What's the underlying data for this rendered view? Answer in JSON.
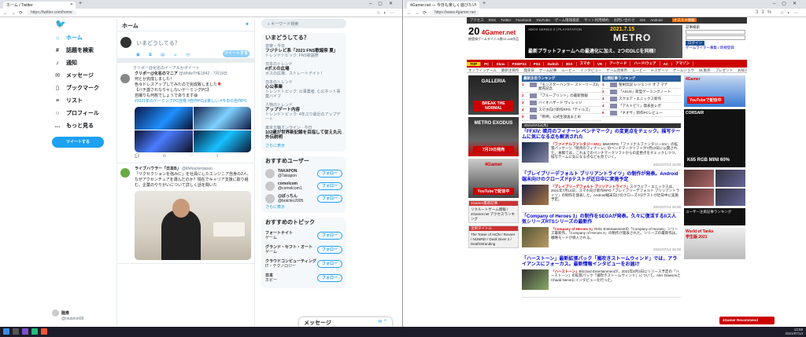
{
  "left_window": {
    "tab_title": "ホーム / Twitter",
    "url": "https://twitter.com/home",
    "nav": [
      {
        "icon": "home-icon",
        "glyph": "⌂",
        "label": "ホーム"
      },
      {
        "icon": "hashtag-icon",
        "glyph": "#",
        "label": "話題を検索"
      },
      {
        "icon": "bell-icon",
        "glyph": "♪",
        "label": "通知"
      },
      {
        "icon": "mail-icon",
        "glyph": "✉",
        "label": "メッセージ"
      },
      {
        "icon": "bookmark-icon",
        "glyph": "▯",
        "label": "ブックマーク"
      },
      {
        "icon": "list-icon",
        "glyph": "≡",
        "label": "リスト"
      },
      {
        "icon": "profile-icon",
        "glyph": "○",
        "label": "プロフィール"
      },
      {
        "icon": "more-icon",
        "glyph": "…",
        "label": "もっと見る"
      }
    ],
    "tweet_button": "ツイートする",
    "user": {
      "name": "陸斎",
      "handle": "@mutekiri08"
    },
    "main": {
      "title": "ホーム",
      "compose_placeholder": "いまどうしてる？",
      "compose_button": "ツイートする",
      "tweets": [
        {
          "retweet_note": "クリポー@化名のイーアルかポイート",
          "name": "クリポー@化名のマニア",
          "handle": "@WhiteTHE1842 · 7月19日",
          "lines": [
            "何とか完成しました！",
            "色々ドレスアップしてみたので完成致しました🎈",
            "【バチ激されなりゃしないゲーミングPC】",
            "自撮りも何枚でしょうであります😄"
          ],
          "tags": "#2021年のゲーミングPC自慢 #自作PCは楽しい #今日の自作PC"
        },
        {
          "name": "ライブハウラー「日本B」",
          "handle": "@lifehackerjapan",
          "lines": [
            "「リクセクションを強みに」を社員にしたエンジニア自身の2人、なぜアクセンチュアを選んだのか？現在でキャリア支援に取り組む、企業のやりがいについて詳しく話を聞いた"
          ]
        }
      ]
    },
    "search_placeholder": "キーワード検索",
    "trends_title": "いまどうしてる？",
    "trends": [
      {
        "sub": "音楽・今日",
        "title": "フジテレビ系「2021 FNS歌謡祭 夏」",
        "meta": "トレンドトピック: FNS歌謡祭"
      },
      {
        "sub": "日本のトレンド",
        "title": "#ボスの広場",
        "meta": "ボスの広場、ストレートデイト！"
      },
      {
        "sub": "日本のトレンド",
        "title": "心公事業",
        "meta": "トレンドトピック: 公事業者, 心公ネット事業バイブ"
      },
      {
        "sub": "人物のトレンド",
        "title": "アップデート内容",
        "meta": "トレンドトピック: 4年ぶり最近のアップデート"
      },
      {
        "sub": "東京五輪オンライン · 今日",
        "title": "102歳が世界新記録を目指して従え丸元外伝説明",
        "meta": ""
      }
    ],
    "trends_more": "さらに表示",
    "follow_title": "おすすめユーザー",
    "follow_users": [
      {
        "name": "TAKAPON",
        "handle": "@Takapon"
      },
      {
        "name": "comolcom",
        "handle": "@comolcom1"
      },
      {
        "name": "@ぼっちん",
        "handle": "@botchin2005"
      }
    ],
    "follow_more": "さらに表示",
    "follow_label": "フォロー",
    "topics_title": "おすすめのトピック",
    "topics": [
      {
        "name": "フォートナイト",
        "sub": "ゲーム"
      },
      {
        "name": "グランド・セフト・オート",
        "sub": "ゲーム"
      },
      {
        "name": "クラウドコンピューティング",
        "sub": "IT・テクノロジー"
      },
      {
        "name": "日本",
        "sub": "ホビー"
      }
    ],
    "messages_label": "メッセージ"
  },
  "right_window": {
    "tab_title": "4Gamer.net — 今日も楽しく遊びたい",
    "url": "https://www.4gamer.net",
    "zoom": "33%",
    "topbar": [
      "アクセス",
      "RSS",
      "Twitter",
      "Facebook",
      "YouTube",
      "ゲーム情報検索",
      "サイト利用規約",
      "お問い合わせ",
      "iOS",
      "Android"
    ],
    "topbar_rec": "オススメ情報",
    "logo": "20",
    "logo_sub": "総登録ゲームタイトル数15,428作品",
    "ad_xbox": "XBOX SERIES X | PLAYSTATION",
    "ad_date": "2021.7.15",
    "ad_title": "METRO",
    "ad_copy": "最新プラットフォームへの最適化に加え、2つのDLCを同梱！",
    "login": {
      "label": "記事検索",
      "btn": "ログイン",
      "links": "ゲームライター募集 / 新規登録"
    },
    "nav": [
      "TOP",
      "PC",
      "Xbox",
      "PS5/PS4",
      "PS4",
      "Switch",
      "3DS",
      "スマホ",
      "VR",
      "アーケード",
      "ハード/ウェア",
      "AC",
      "アマゾン"
    ],
    "sub_nav": [
      "オンラインゲーム",
      "最新注目作",
      "発売日",
      "ゲーム記事",
      "ムービー",
      "インタビュー",
      "ゲーム見本市",
      "ムービー",
      "e-スポーツ",
      "ゲームショウ",
      "DL販売",
      "プレゼント",
      "お知らせ"
    ],
    "left_cards": [
      {
        "title": "GALLERIA",
        "tag": "BREAK THE NORMAL"
      },
      {
        "title": "METRO EXODUS",
        "tag": "7月19日発売"
      },
      {
        "title": "4Gamer",
        "tag": "YouTubeで配信中"
      }
    ],
    "left_boxes": [
      {
        "head": "4Gamer最新記事",
        "text": "リクルートゲーム情報 / 4Gamer.net アクセスランキング"
      },
      {
        "head": "注目タイトル",
        "text": "The Tower of AION / Rouser / NUNREI / Dusk Diver 2 / DeathStranding"
      }
    ],
    "rank_heads": [
      "最新注目ランキング",
      "公開記事ランキング"
    ],
    "rank_left": [
      {
        "n": "1",
        "t": "「モンスターハンター ストーリーズ2」発売記念"
      },
      {
        "n": "2",
        "t": "「ブループリント」の最新情報"
      },
      {
        "n": "3",
        "t": "バイオハザード ヴィレッジ"
      },
      {
        "n": "4",
        "t": "スマホ向け新作RPG「テイルズ」"
      },
      {
        "n": "5",
        "t": "「原神」公式生放送まとめ"
      }
    ],
    "rank_right": [
      {
        "n": "1",
        "t": "聖剣伝説 レジェンド オブ マナ"
      },
      {
        "n": "2",
        "t": "「ASUS」新型ゲーミングノート"
      },
      {
        "n": "3",
        "t": "スクエア・エニックス新作"
      },
      {
        "n": "4",
        "t": "「アルトピリ」発表会レポ"
      },
      {
        "n": "5",
        "t": "「ネオサ」新作PCレビュー"
      }
    ],
    "date_bar": "2021/07/14(木)",
    "articles": [
      {
        "title": "「FFXIV: 暁月のフィナーレ ベンチマーク」の変更点をチェック。描写テームに気になる点も解消された",
        "body": "MMORPG「ファイナルファンタジーXIV」の拡張パッケージ「暁月のフィナーレ」のベンチマークソフトが7月13日に公開された。本稿では，これまでのベンチマークソフトからの変更点をチェックしつつ，描写テームに気になる点なども見ていく。",
        "highlight": "「ファイナルファンタジーXIV」",
        "time": "2021/07/14 16:00"
      },
      {
        "title": "「ブレイブリーデフォルト ブリリアントライツ」の制作が発表。Android端末向けのクローズドβテストが近日中に実施予定",
        "body": "スクウェア・エニックスは，2021年7月14日，スマホ向け新作RPG「ブレイブリーデフォルト ブリリアントライツ」の制作を発表した。Android端末向けのクローズドβテストが近日中に実施予定。",
        "highlight": "「ブレイブリーデフォルト ブリリアントライツ」",
        "time": "2021/07/14 16:00"
      },
      {
        "title": "「Company of Heroes 3」の制作をSEGAが発表。久々に復活するIIス人気シリーズRTSシリーズの最新作",
        "body": "Relic Entertainmentの「Company of Heroes」シリーズ最新作，「Company of Heroes 3」の制作が発表された。シリーズの最新作は，戦略モードが導入される。",
        "highlight": "「Company of Heroes 3」",
        "time": "2021/07/14 16:00"
      },
      {
        "title": "「ハーストーン」最新拡張パック「嵐吹きストームウィンド」では，アライアンスにフォーカス。最新情報インタビューをお届け",
        "body": "Blizzard Entertainmentが，2021年8月3日にリリース予定の「ハーストーン」の拡張パック「嵐吹きストームウィンド」について，Alec DawsonとChadd Nerveにインタビューを行った。",
        "highlight": "「ハーストーン」",
        "time": ""
      }
    ],
    "right_ads": [
      {
        "title": "4Gamer",
        "sub": "YouTubeで配信中"
      },
      {
        "title": "CORSAIR",
        "sub": "K65 RGB MINI 60%"
      },
      {
        "title": "World of Tanks",
        "sub": "学生版 2021"
      }
    ],
    "right_dark": "ユーザー注目記事ランキング",
    "recommend": "4Gamer Recommend"
  },
  "taskbar": {
    "time": "13:58",
    "date": "2021/07/14"
  },
  "colors": {
    "twitter_blue": "#1da1f2",
    "gamer_red": "#cc0000",
    "gamer_yellow": "#ffcc00"
  }
}
